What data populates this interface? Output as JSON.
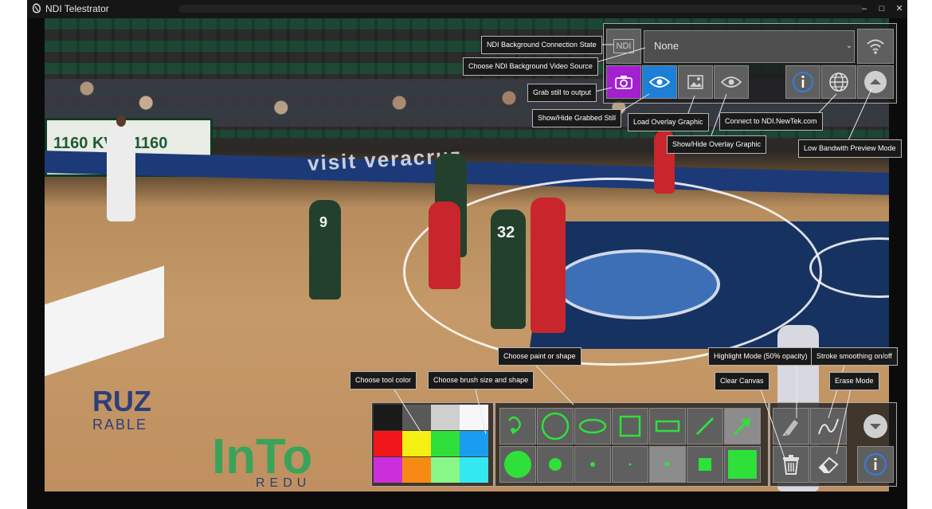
{
  "window": {
    "title": "NDI Telestrator",
    "controls": [
      "–",
      "□",
      "✕"
    ]
  },
  "video": {
    "signs": [
      "1160 KVCE",
      "1160 KVCE"
    ],
    "baseline_text": "visit veracruz",
    "court_text_left": "RUZ",
    "court_text_left_sub": "RABLE",
    "court_text_bottom": "InTo",
    "court_text_bottom_sub": "REDU",
    "jersey_numbers": [
      "9",
      "32"
    ]
  },
  "ndi": {
    "badge": "NDI",
    "source_value": "None"
  },
  "tooltips": {
    "connection_state": "NDI Background Connection State",
    "video_source": "Choose NDI Background Video Source",
    "grab_still": "Grab still to output",
    "show_hide_grabbed": "Show/Hide Grabbed Still",
    "load_overlay": "Load Overlay Graphic",
    "show_hide_overlay": "Show/Hide Overlay Graphic",
    "connect_newtek": "Connect to NDI.NewTek.com",
    "low_bandwidth": "Low Bandwith Preview Mode",
    "tool_color": "Choose tool color",
    "brush_size": "Choose brush size and shape",
    "paint_shape": "Choose paint or shape",
    "highlight_mode": "Highlight Mode (50% opacity)",
    "stroke_smoothing": "Stroke smoothing on/off",
    "clear_canvas": "Clear Canvas",
    "erase_mode": "Erase Mode"
  },
  "colors": {
    "purple": "#a31fd0",
    "blue": "#1e7fd6",
    "green": "#2fe03a",
    "info": "#2f7fe0",
    "palette": [
      "#1a1a1a",
      "#595959",
      "#cfcfcf",
      "#f7f7f7",
      "#f0161a",
      "#f6ef13",
      "#2fe03a",
      "#1a9cf0",
      "#cb2fdc",
      "#f78a14",
      "#88f787",
      "#33e8f0"
    ]
  },
  "icons": {
    "top": [
      "ndi-badge",
      "camera-icon",
      "eye-icon",
      "image-icon",
      "eye-icon",
      "info-icon",
      "globe-icon",
      "wifi-icon",
      "chevron-up-icon"
    ],
    "bottom": [
      "freehand-icon",
      "circle-outline-icon",
      "ellipse-outline-icon",
      "square-outline-icon",
      "rectangle-outline-icon",
      "line-icon",
      "arrow-icon",
      "brush-size-icons",
      "highlighter-icon",
      "smoothing-icon",
      "trash-icon",
      "eraser-icon",
      "chevron-down-icon",
      "info-icon"
    ]
  }
}
